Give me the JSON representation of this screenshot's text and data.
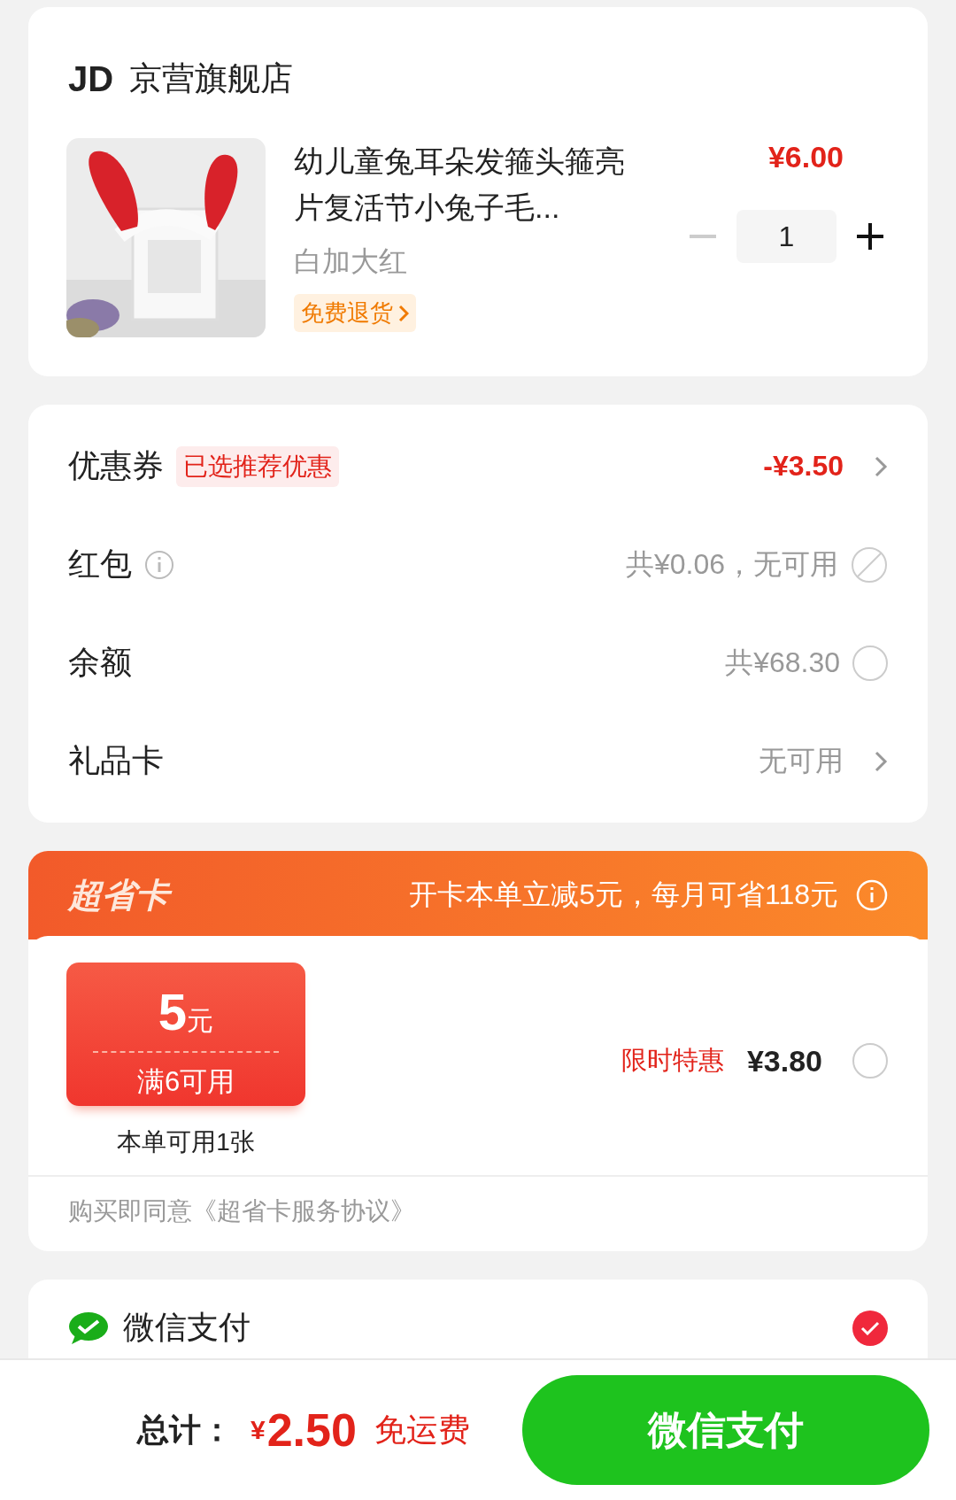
{
  "store": {
    "logo": "JD",
    "name": "京营旗舰店"
  },
  "product": {
    "title": "幼儿童兔耳朵发箍头箍亮片复活节小兔子毛...",
    "variant": "白加大红",
    "tag": "免费退货",
    "price": "¥6.00",
    "quantity": "1",
    "decrement_disabled": true
  },
  "options": [
    {
      "kind": "discount",
      "label": "优惠券",
      "tag": "已选推荐优惠",
      "value": "-¥3.50"
    },
    {
      "kind": "unavailable",
      "label": "红包",
      "info": true,
      "value": "共¥0.06，无可用"
    },
    {
      "kind": "radio",
      "label": "余额",
      "value": "共¥68.30",
      "checked": false
    },
    {
      "kind": "link",
      "label": "礼品卡",
      "value": "无可用"
    }
  ],
  "super_card": {
    "title": "超省卡",
    "promo": "开卡本单立减5元，每月可省118元",
    "coupon_amount": "5",
    "coupon_unit": "元",
    "coupon_condition": "满6可用",
    "coupon_note": "本单可用1张",
    "offer_label": "限时特惠",
    "offer_price": "¥3.80",
    "checked": false,
    "agreement": "购买即同意《超省卡服务协议》"
  },
  "payment": {
    "method": "微信支付",
    "checked": true
  },
  "footer": {
    "total_label": "总计：",
    "currency": "¥",
    "total": "2.50",
    "shipping": "免运费",
    "pay_button": "微信支付"
  }
}
